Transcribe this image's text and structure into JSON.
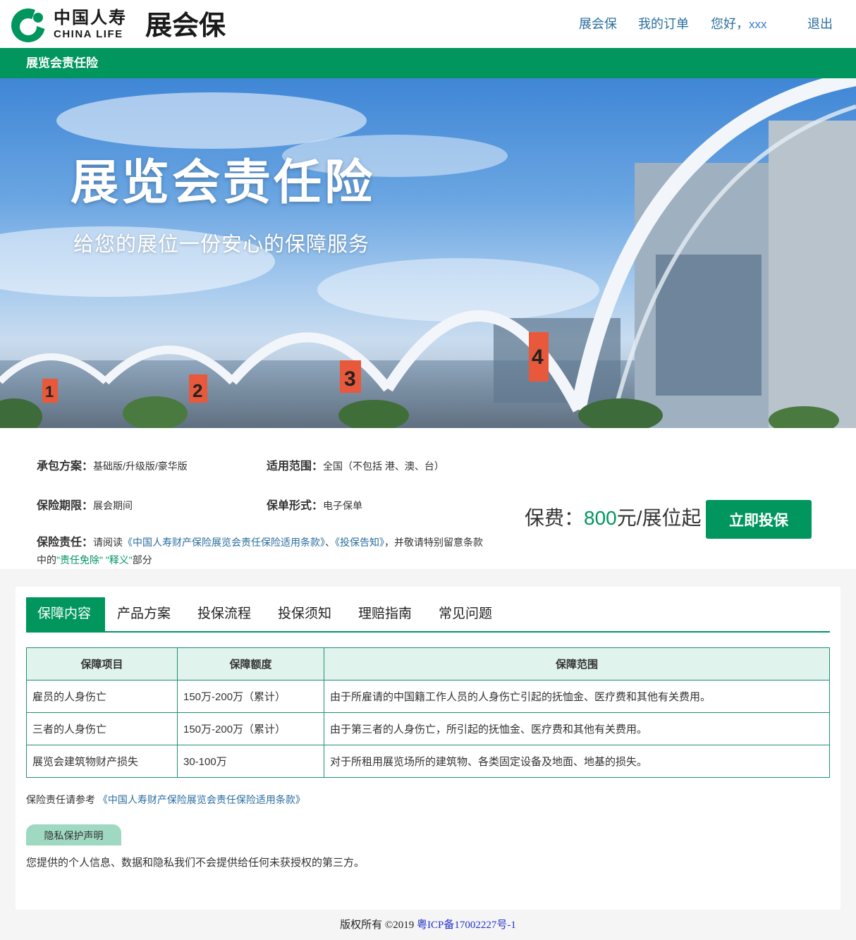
{
  "header": {
    "logo_cn": "中国人寿",
    "logo_en": "CHINA LIFE",
    "product": "展会保",
    "nav": {
      "home": "展会保",
      "orders": "我的订单",
      "greeting": "您好，",
      "user": "xxx",
      "logout": "退出"
    }
  },
  "title_bar": "展览会责任险",
  "banner": {
    "title": "展览会责任险",
    "subtitle": "给您的展位一份安心的保障服务",
    "hall_numbers": [
      "1",
      "2",
      "3",
      "4"
    ]
  },
  "info": {
    "plan_label": "承包方案：",
    "plan_value": "基础版/升级版/豪华版",
    "scope_label": "适用范围：",
    "scope_value": "全国（不包括 港、澳、台）",
    "period_label": "保险期限：",
    "period_value": "展会期间",
    "form_label": "保单形式：",
    "form_value": "电子保单",
    "liability_label": "保险责任：",
    "liability_pre": "请阅读",
    "liability_link1": "《中国人寿财产保险展览会责任保险适用条款》",
    "liability_sep": "、",
    "liability_link2": "《投保告知》",
    "liability_mid": "，并敬请特别留意条款中的",
    "liability_hl": "\"责任免除\" \"释义\"",
    "liability_post": "部分"
  },
  "price": {
    "label": "保费：",
    "amount": "800",
    "unit": "元/展位起"
  },
  "buy_button": "立即投保",
  "tabs": [
    "保障内容",
    "产品方案",
    "投保流程",
    "投保须知",
    "理赔指南",
    "常见问题"
  ],
  "table": {
    "headers": [
      "保障项目",
      "保障额度",
      "保障范围"
    ],
    "rows": [
      [
        "雇员的人身伤亡",
        "150万-200万（累计）",
        "由于所雇请的中国籍工作人员的人身伤亡引起的抚恤金、医疗费和其他有关费用。"
      ],
      [
        "三者的人身伤亡",
        "150万-200万（累计）",
        "由于第三者的人身伤亡，所引起的抚恤金、医疗费和其他有关费用。"
      ],
      [
        "展览会建筑物财产损失",
        "30-100万",
        "对于所租用展览场所的建筑物、各类固定设备及地面、地基的损失。"
      ]
    ]
  },
  "reference": {
    "text": "保险责任请参考",
    "link": "《中国人寿财产保险展览会责任保险适用条款》"
  },
  "privacy": {
    "tag": "隐私保护声明",
    "text": "您提供的个人信息、数据和隐私我们不会提供给任何未获授权的第三方。"
  },
  "footer": {
    "copyright": "版权所有 ©2019 ",
    "icp": "粤ICP备17002227号-1"
  },
  "colors": {
    "brand_green": "#00965e",
    "link_blue": "#2a6e9e",
    "table_header_bg": "#e0f3ec"
  }
}
